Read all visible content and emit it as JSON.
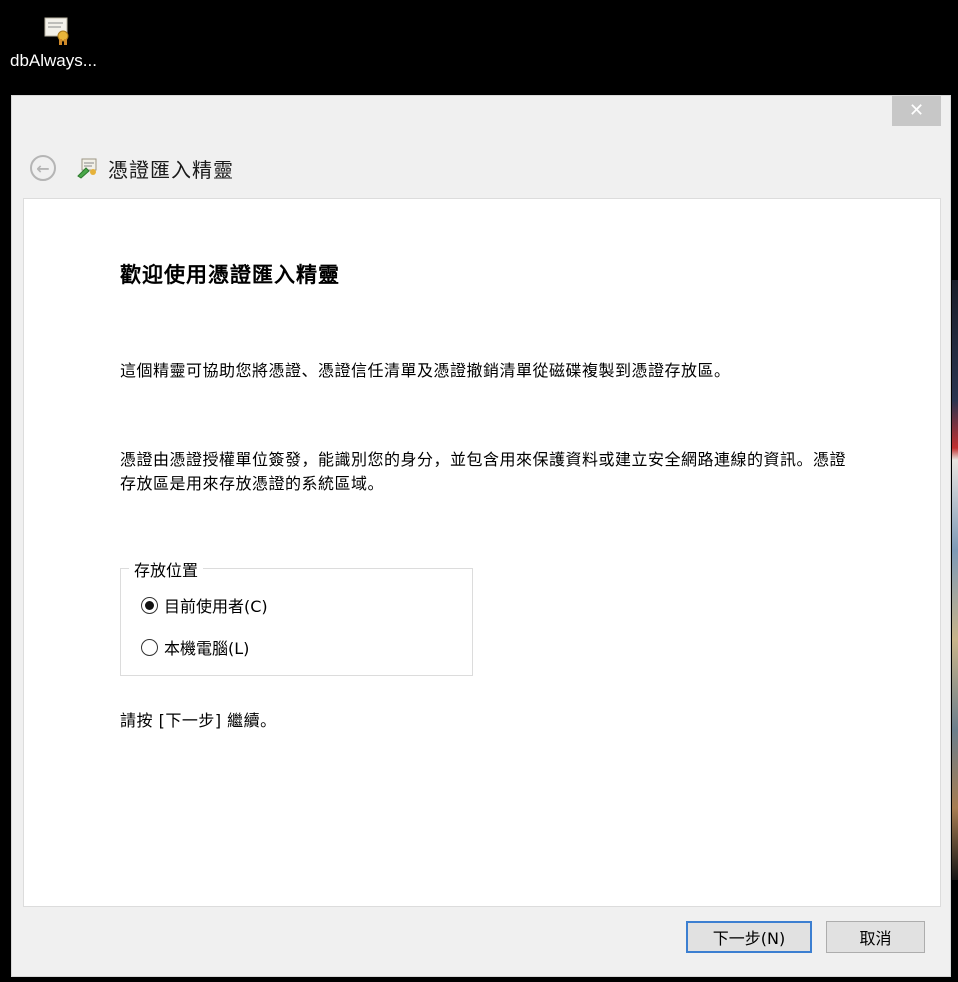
{
  "desktop": {
    "icon_label": "dbAlways..."
  },
  "window": {
    "close_symbol": "✕",
    "back_symbol": "←",
    "title": "憑證匯入精靈"
  },
  "content": {
    "heading": "歡迎使用憑證匯入精靈",
    "paragraph1": "這個精靈可協助您將憑證、憑證信任清單及憑證撤銷清單從磁碟複製到憑證存放區。",
    "paragraph2": "憑證由憑證授權單位簽發，能識別您的身分，並包含用來保護資料或建立安全網路連線的資訊。憑證存放區是用來存放憑證的系統區域。",
    "store_location": {
      "legend": "存放位置",
      "options": [
        {
          "label": "目前使用者(C)",
          "selected": true
        },
        {
          "label": "本機電腦(L)",
          "selected": false
        }
      ]
    },
    "instruction": "請按 [下一步] 繼續。"
  },
  "footer": {
    "next_label": "下一步(N)",
    "cancel_label": "取消"
  },
  "colors": {
    "accent_focus": "#3c7fd1",
    "window_bg": "#f0f0f0",
    "content_bg": "#ffffff"
  },
  "icons": {
    "desktop_icon": "certificate-file-icon",
    "wizard_icon": "certificate-wizard-icon",
    "back_icon": "back-arrow-icon",
    "close_icon": "close-icon"
  }
}
